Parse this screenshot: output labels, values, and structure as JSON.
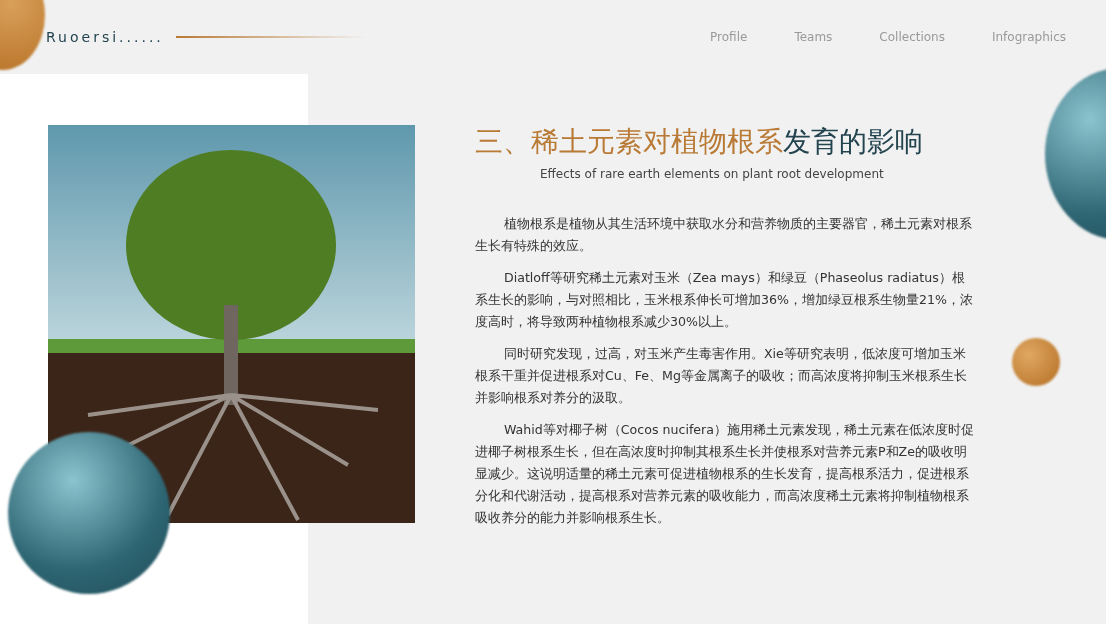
{
  "header": {
    "logo": "Ruoersi......"
  },
  "nav": [
    {
      "label": "Profile"
    },
    {
      "label": "Teams"
    },
    {
      "label": "Collections"
    },
    {
      "label": "Infographics"
    }
  ],
  "title_parts": [
    {
      "text": "三、稀土元素对植物根系",
      "color": "#b97a35"
    },
    {
      "text": "发育的影响",
      "color": "#23444f"
    }
  ],
  "subtitle": "Effects of rare earth elements on plant root development",
  "paragraphs": [
    "植物根系是植物从其生活环境中获取水分和营养物质的主要器官，稀土元素对根系生长有特殊的效应。",
    "Diatloff等研究稀土元素对玉米（Zea mays）和绿豆（Phaseolus radiatus）根系生长的影响，与对照相比，玉米根系伸长可增加36%，增加绿豆根系生物量21%，浓度高时，将导致两种植物根系减少30%以上。",
    "同时研究发现，过高，对玉米产生毒害作用。Xie等研究表明，低浓度可增加玉米根系干重并促进根系对Cu、Fe、Mg等金属离子的吸收；而高浓度将抑制玉米根系生长并影响根系对养分的汲取。",
    "Wahid等对椰子树（Cocos nucifera）施用稀土元素发现，稀土元素在低浓度时促进椰子树根系生长，但在高浓度时抑制其根系生长并使根系对营养元素P和Ze的吸收明显减少。这说明适量的稀土元素可促进植物根系的生长发育，提高根系活力，促进根系分化和代谢活动，提高根系对营养元素的吸收能力，而高浓度稀土元素将抑制植物根系吸收养分的能力并影响根系生长。"
  ]
}
